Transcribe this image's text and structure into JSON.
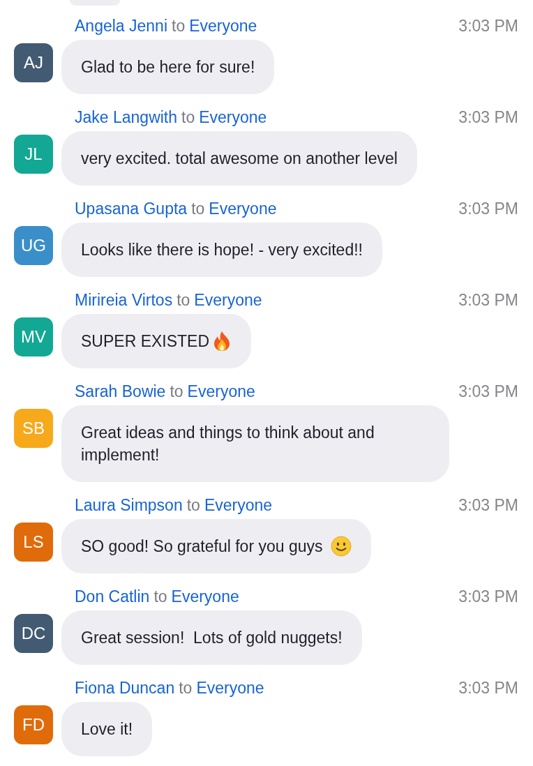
{
  "messages": [
    {
      "kind": "plain",
      "sender": "Angela Jenni",
      "connector": "to",
      "recipient": "Everyone",
      "time": "3:03 PM",
      "initials": "AJ",
      "color": "#435a73",
      "text": "Glad to be here for sure!"
    },
    {
      "kind": "plain",
      "sender": "Jake Langwith",
      "connector": "to",
      "recipient": "Everyone",
      "time": "3:03 PM",
      "initials": "JL",
      "color": "#12a894",
      "text": "very excited. total awesome on another level"
    },
    {
      "kind": "plain",
      "sender": "Upasana Gupta",
      "connector": "to",
      "recipient": "Everyone",
      "time": "3:03 PM",
      "initials": "UG",
      "color": "#3a8fc8",
      "text": "Looks like there is hope! - very excited!!"
    },
    {
      "kind": "fire",
      "sender": "Mirireia Virtos",
      "connector": "to",
      "recipient": "Everyone",
      "time": "3:03 PM",
      "initials": "MV",
      "color": "#12a894",
      "text": "SUPER EXISTED"
    },
    {
      "kind": "plain",
      "sender": "Sarah Bowie",
      "connector": "to",
      "recipient": "Everyone",
      "time": "3:03 PM",
      "initials": "SB",
      "color": "#f6a91b",
      "text": "Great ideas and things to think about and implement!"
    },
    {
      "kind": "smiley",
      "sender": "Laura Simpson",
      "connector": "to",
      "recipient": "Everyone",
      "time": "3:03 PM",
      "initials": "LS",
      "color": "#e06b0a",
      "text": "SO good! So grateful for you guys"
    },
    {
      "kind": "plain",
      "sender": "Don Catlin",
      "connector": "to",
      "recipient": "Everyone",
      "time": "3:03 PM",
      "initials": "DC",
      "color": "#435a73",
      "text": "Great session!  Lots of gold nuggets!"
    },
    {
      "kind": "plain",
      "sender": "Fiona Duncan",
      "connector": "to",
      "recipient": "Everyone",
      "time": "3:03 PM",
      "initials": "FD",
      "color": "#e06b0a",
      "text": "Love it!"
    }
  ]
}
